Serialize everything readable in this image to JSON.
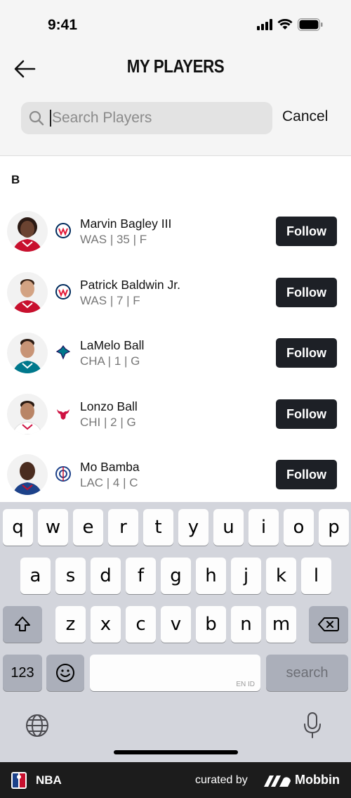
{
  "status": {
    "time": "9:41"
  },
  "header": {
    "title": "MY PLAYERS"
  },
  "search": {
    "placeholder": "Search Players",
    "value": "",
    "cancel_label": "Cancel"
  },
  "section": {
    "letter": "B"
  },
  "players": [
    {
      "name": "Marvin Bagley III",
      "meta": "WAS | 35 | F",
      "team": "wizards",
      "follow_label": "Follow"
    },
    {
      "name": "Patrick Baldwin Jr.",
      "meta": "WAS | 7 | F",
      "team": "wizards",
      "follow_label": "Follow"
    },
    {
      "name": "LaMelo Ball",
      "meta": "CHA | 1 | G",
      "team": "hornets",
      "follow_label": "Follow"
    },
    {
      "name": "Lonzo Ball",
      "meta": "CHI | 2 | G",
      "team": "bulls",
      "follow_label": "Follow"
    },
    {
      "name": "Mo Bamba",
      "meta": "LAC | 4 | C",
      "team": "clippers",
      "follow_label": "Follow"
    }
  ],
  "keyboard": {
    "row1": [
      "q",
      "w",
      "e",
      "r",
      "t",
      "y",
      "u",
      "i",
      "o",
      "p"
    ],
    "row2": [
      "a",
      "s",
      "d",
      "f",
      "g",
      "h",
      "j",
      "k",
      "l"
    ],
    "row3": [
      "z",
      "x",
      "c",
      "v",
      "b",
      "n",
      "m"
    ],
    "numbers_label": "123",
    "space_hint": "EN ID",
    "return_label": "search"
  },
  "footer": {
    "app_name": "NBA",
    "curated_by": "curated by",
    "brand": "Mobbin"
  },
  "colors": {
    "follow_bg": "#1d2026",
    "header_bg": "#f5f5f5",
    "keyboard_bg": "#d3d5dc",
    "footer_bg": "#1c1c1c"
  }
}
